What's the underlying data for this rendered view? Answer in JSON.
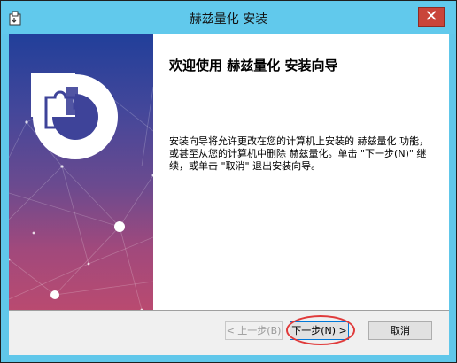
{
  "window": {
    "title": "赫兹量化 安装",
    "close_glyph": "✕",
    "app_icon": "installer-icon"
  },
  "banner": {
    "logo": "puzzle-logo-icon",
    "colors": {
      "top": "#213f9a",
      "bottom": "#b94a70"
    }
  },
  "content": {
    "heading": "欢迎使用 赫兹量化 安装向导",
    "body": "安装向导将允许更改在您的计算机上安装的 赫兹量化 功能，或甚至从您的计算机中删除 赫兹量化。单击 \"下一步(N)\" 继续，或单击 \"取消\" 退出安装向导。"
  },
  "buttons": {
    "back": "< 上一步(B)",
    "next": "下一步(N) >",
    "cancel": "取消"
  },
  "annotation": {
    "color": "#e03a3a"
  }
}
